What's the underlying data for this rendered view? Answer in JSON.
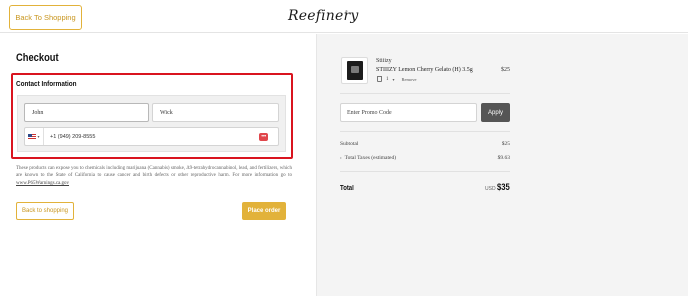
{
  "header": {
    "back_label": "Back To Shopping",
    "logo_text": "Reefinery",
    "logo_mark": "®"
  },
  "checkout": {
    "title": "Checkout",
    "contact": {
      "title": "Contact Information",
      "first_name": "John",
      "last_name": "Wick",
      "phone": "+1 (949) 209-8555",
      "country_flag": "us-flag-icon",
      "phone_menu_icon": "dots-icon"
    },
    "disclaimer_text": "These products can expose you to chemicals including marijuana (Cannabis) smoke, Δ9-tetrahydrocannabinol, lead, and fertilizers, which are known to the State of California to cause cancer and birth defects or other reproductive harm. For more information go to",
    "disclaimer_link": "www.P65Warnings.ca.gov",
    "back_button_label": "Back to shopping",
    "place_order_label": "Place order"
  },
  "summary": {
    "item": {
      "brand": "Stiiizy",
      "name": "STIIIZY Lemon Cherry Gelato (H) 3.5g",
      "price": "$25",
      "quantity": "1",
      "remove_label": "Remove"
    },
    "promo_placeholder": "Enter Promo Code",
    "apply_label": "Apply",
    "subtotal_label": "Subtotal",
    "subtotal_value": "$25",
    "taxes_label": "Total Taxes (estimated)",
    "taxes_value": "$9.63",
    "total_label": "Total",
    "total_currency": "USD",
    "total_value": "$35"
  },
  "colors": {
    "accent_gold": "#e2b23a",
    "highlight_red": "#d9141f",
    "apply_button": "#555555",
    "summary_bg": "#f4f4f4"
  }
}
